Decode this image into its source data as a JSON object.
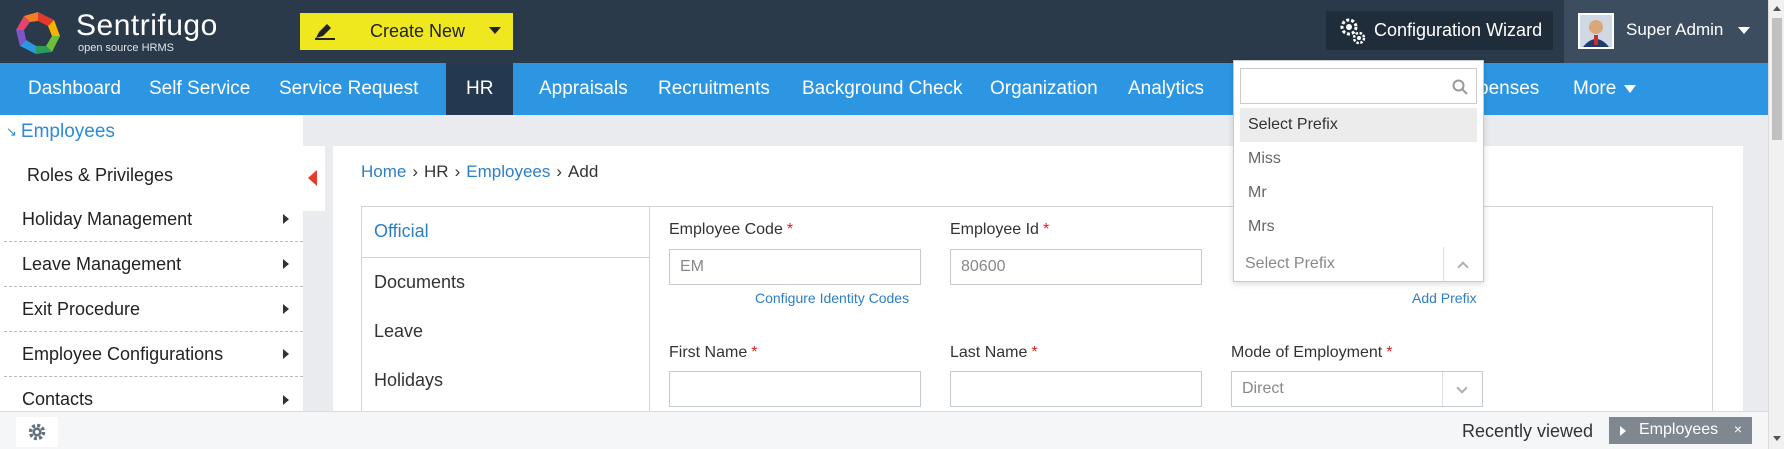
{
  "brand": {
    "title": "Sentrifugo",
    "subtitle": "open source HRMS"
  },
  "header": {
    "create_label": "Create New",
    "config_label": "Configuration Wizard",
    "user_name": "Super Admin"
  },
  "nav": {
    "items": [
      "Dashboard",
      "Self Service",
      "Service Request",
      "HR",
      "Appraisals",
      "Recruitments",
      "Background Check",
      "Organization",
      "Analytics",
      "Expenses",
      "More"
    ],
    "active": "HR",
    "expenses_visible": "penses"
  },
  "sidebar": {
    "heading": "Employees",
    "items": [
      "Roles & Privileges",
      "Holiday Management",
      "Leave Management",
      "Exit Procedure",
      "Employee Configurations",
      "Contacts"
    ]
  },
  "breadcrumb": {
    "home": "Home",
    "hr": "HR",
    "employees": "Employees",
    "current": "Add"
  },
  "tabs": [
    "Official",
    "Documents",
    "Leave",
    "Holidays"
  ],
  "form": {
    "employee_code": {
      "label": "Employee Code",
      "value": "EM",
      "link": "Configure Identity Codes"
    },
    "employee_id": {
      "label": "Employee Id",
      "value": "80600"
    },
    "prefix": {
      "link": "Add Prefix"
    },
    "first_name": {
      "label": "First Name",
      "value": ""
    },
    "last_name": {
      "label": "Last Name",
      "value": ""
    },
    "mode": {
      "label": "Mode of Employment",
      "value": "Direct"
    },
    "required_mark": "*"
  },
  "prefix_dropdown": {
    "search_value": "",
    "options": [
      "Select Prefix",
      "Miss",
      "Mr",
      "Mrs"
    ],
    "highlighted": "Select Prefix",
    "current": "Select Prefix"
  },
  "footer": {
    "recent_label": "Recently viewed",
    "recent_item": "Employees",
    "close": "×"
  },
  "colors": {
    "topbar": "#2a3a4a",
    "nav": "#2d96e3",
    "nav_active": "#24394f",
    "create": "#f0e81f",
    "link": "#2d7fc4"
  }
}
